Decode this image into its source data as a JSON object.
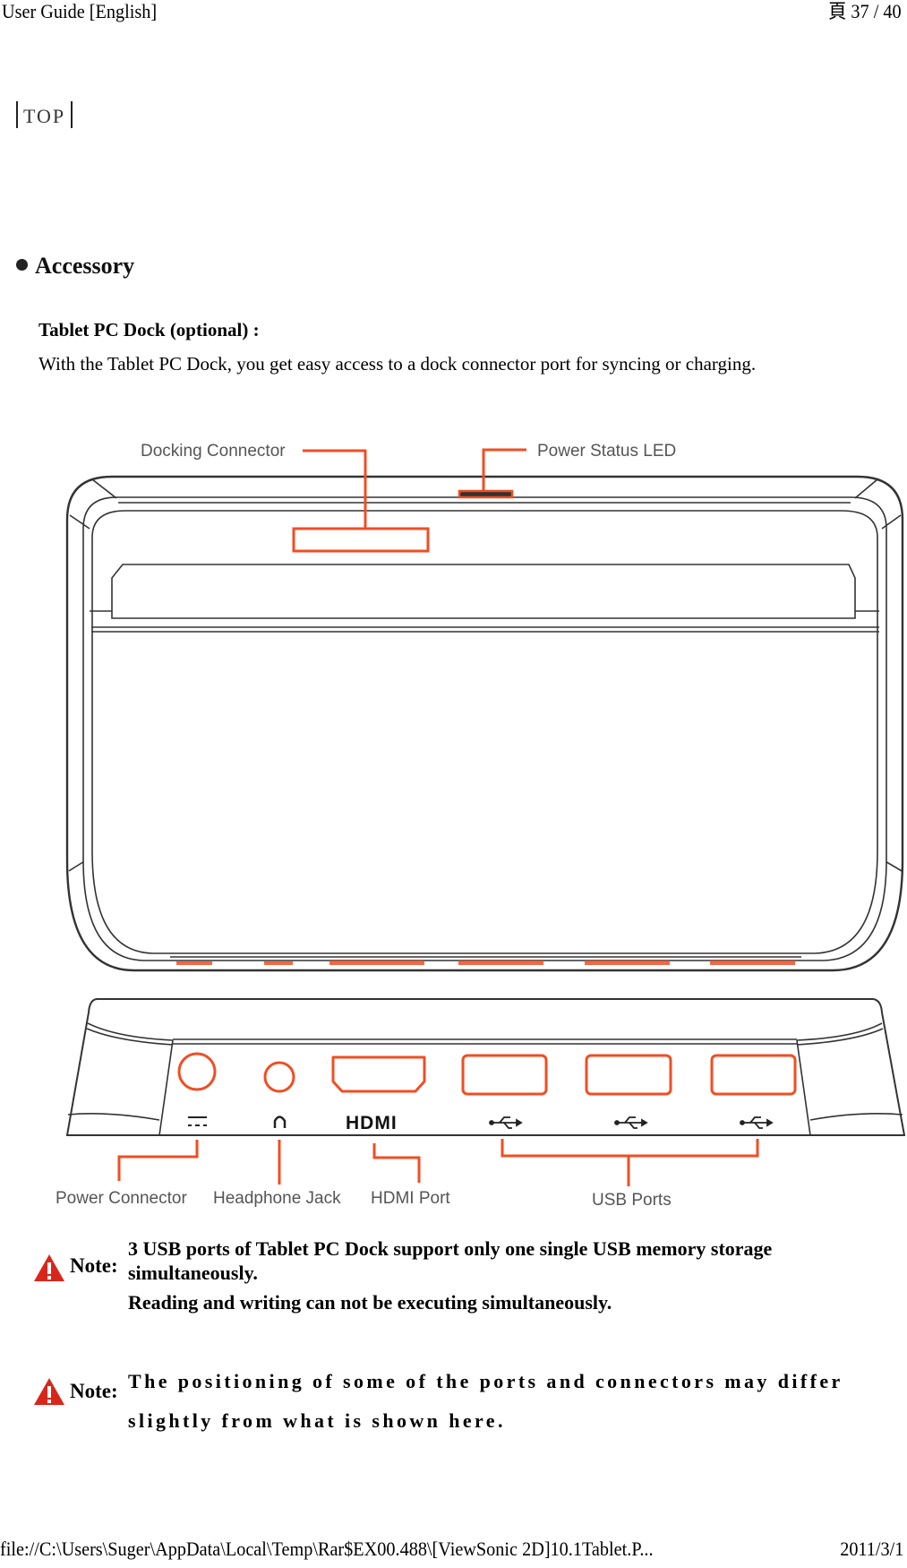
{
  "header": {
    "title": "User Guide [English]",
    "page_indicator": "頁 37 / 40"
  },
  "nav": {
    "top_link": "TOP"
  },
  "section": {
    "title": "Accessory"
  },
  "dock": {
    "title": "Tablet PC Dock (optional) :",
    "description": "With the Tablet PC Dock, you get easy access to a dock connector port for syncing or charging."
  },
  "diagram": {
    "accent_color": "#f04e23",
    "line_color": "#333333",
    "top_view_labels": {
      "docking_connector": "Docking Connector",
      "power_status_led": "Power Status LED"
    },
    "rear_view_labels": {
      "power_connector": "Power Connector",
      "headphone_jack": "Headphone Jack",
      "hdmi_port": "HDMI Port",
      "usb_ports": "USB Ports"
    },
    "port_icons": {
      "power": "dc-power-icon",
      "headphone": "headphone-icon",
      "hdmi": "HDMI",
      "usb": [
        "usb-icon",
        "usb-icon",
        "usb-icon"
      ]
    }
  },
  "notes": [
    {
      "icon": "warning-icon",
      "label": "Note:",
      "lines": [
        "3 USB ports of Tablet PC Dock support only one single USB memory storage",
        "simultaneously.",
        "Reading and writing can not be executing simultaneously."
      ]
    },
    {
      "icon": "warning-icon",
      "label": "Note:",
      "lines": [
        "The positioning of some of the ports and connectors may differ",
        "slightly from what is shown here."
      ]
    }
  ],
  "footer": {
    "path": "file://C:\\Users\\Suger\\AppData\\Local\\Temp\\Rar$EX00.488\\[ViewSonic 2D]10.1Tablet.P...",
    "date": "2011/3/1"
  }
}
